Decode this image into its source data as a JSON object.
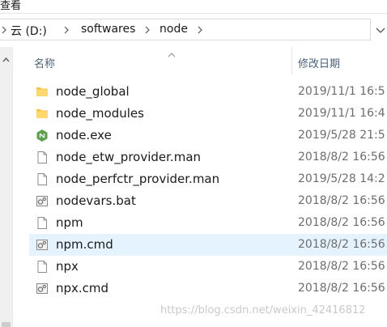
{
  "menu": {
    "label": "查看"
  },
  "address": {
    "breadcrumbs": [
      "云 (D:)",
      "softwares",
      "node"
    ]
  },
  "columns": {
    "name": "名称",
    "date": "修改日期"
  },
  "files": [
    {
      "name": "node_global",
      "date": "2019/11/1 16:5",
      "icon": "folder-icon"
    },
    {
      "name": "node_modules",
      "date": "2019/11/1 16:4",
      "icon": "folder-icon"
    },
    {
      "name": "node.exe",
      "date": "2019/5/28 21:5",
      "icon": "nodejs-exe-icon"
    },
    {
      "name": "node_etw_provider.man",
      "date": "2018/8/2 16:56",
      "icon": "file-icon"
    },
    {
      "name": "node_perfctr_provider.man",
      "date": "2019/5/28 14:2",
      "icon": "file-icon"
    },
    {
      "name": "nodevars.bat",
      "date": "2018/8/2 16:56",
      "icon": "batch-file-icon"
    },
    {
      "name": "npm",
      "date": "2018/8/2 16:56",
      "icon": "file-icon"
    },
    {
      "name": "npm.cmd",
      "date": "2018/8/2 16:56",
      "icon": "batch-file-icon",
      "selected": true
    },
    {
      "name": "npx",
      "date": "2018/8/2 16:56",
      "icon": "file-icon"
    },
    {
      "name": "npx.cmd",
      "date": "2018/8/2 16:56",
      "icon": "batch-file-icon"
    }
  ],
  "watermark": "https://blog.csdn.net/weixin_42416812",
  "colors": {
    "selection": "#e5f3ff",
    "folder": "#f6c443",
    "node_green": "#5fa04e",
    "header_text": "#4c607a"
  }
}
